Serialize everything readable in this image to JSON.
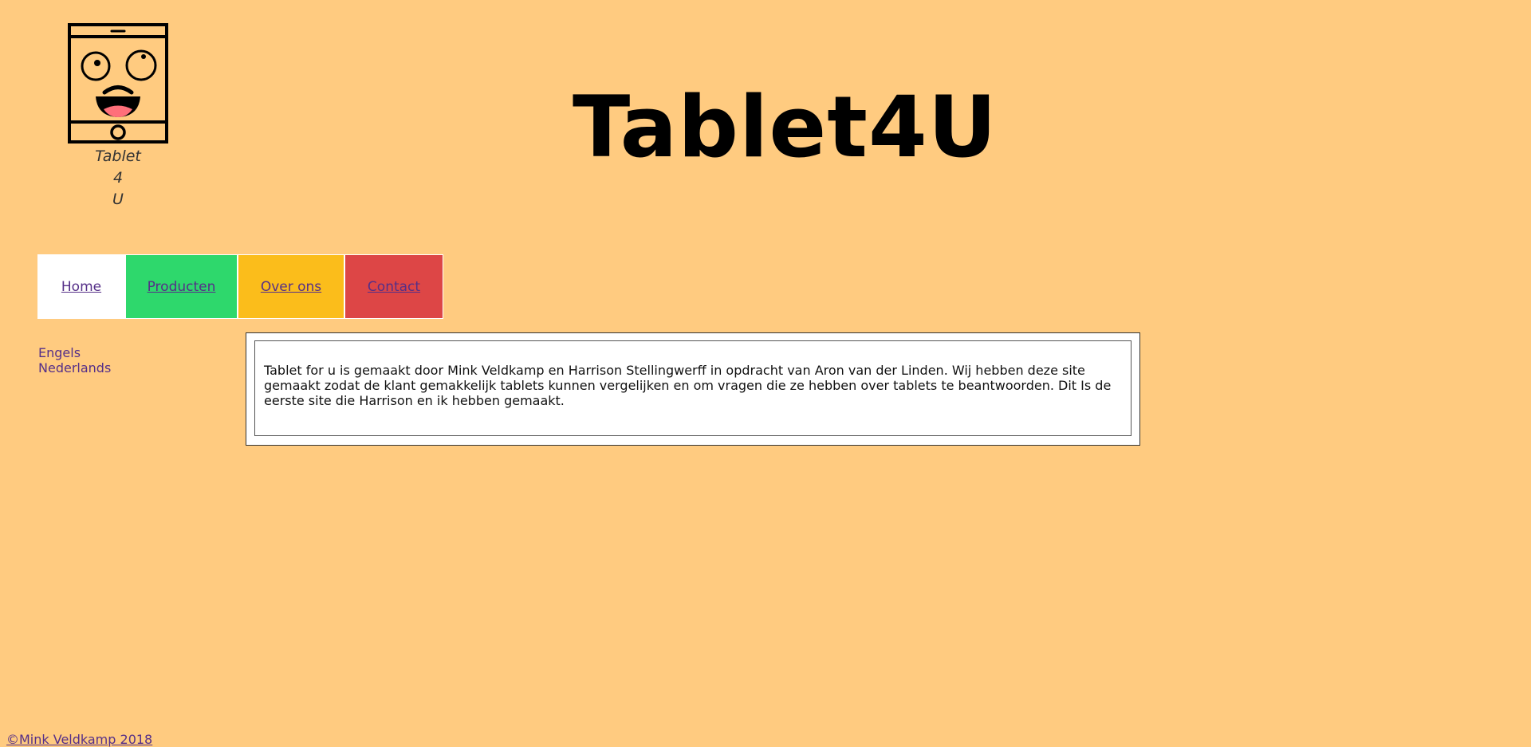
{
  "logo": {
    "icon": "tablet-face-logo",
    "caption_lines": [
      "Tablet",
      "4",
      "U"
    ]
  },
  "header": {
    "title": "Tablet4U"
  },
  "nav": {
    "items": [
      {
        "label": "Home",
        "color": "#ffffff"
      },
      {
        "label": "Producten",
        "color": "#2ed86c"
      },
      {
        "label": "Over ons",
        "color": "#fbbd1b"
      },
      {
        "label": "Contact",
        "color": "#dd4646"
      }
    ]
  },
  "languages": [
    "Engels",
    "Nederlands"
  ],
  "content": {
    "text": "Tablet for u is gemaakt door Mink Veldkamp en Harrison Stellingwerff in opdracht van Aron van der Linden. Wij hebben deze site gemaakt zodat de klant gemakkelijk tablets kunnen vergelijken en om vragen die ze hebben over tablets te beantwoorden. Dit Is de eerste site die Harrison en ik hebben gemaakt."
  },
  "footer": {
    "copyright": "©Mink Veldkamp 2018"
  },
  "colors": {
    "background": "#FFCB80",
    "link": "#552f88"
  }
}
